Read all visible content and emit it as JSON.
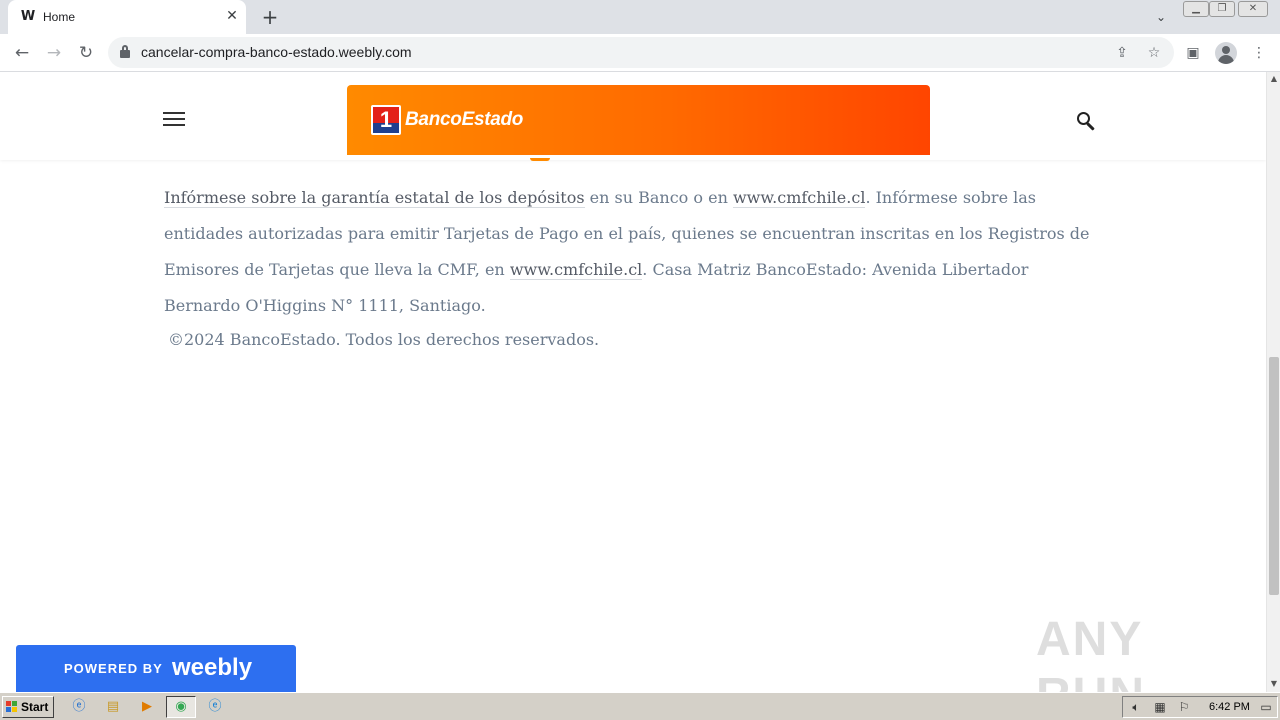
{
  "browser": {
    "tab": {
      "title": "Home",
      "favicon": "W"
    },
    "address": {
      "url": "cancelar-compra-banco-estado.weebly.com"
    }
  },
  "site": {
    "logo_text": "BancoEstado",
    "logo_mark_digit": "1",
    "paragraph": {
      "p1": "Infórmese sobre la garantía estatal de los depósitos",
      "p2": " en su Banco o en ",
      "link1": "www.cmfchile.cl",
      "p3": ". Infórmese sobre las entidades autorizadas para emitir Tarjetas de Pago en el país, quienes se encuentran inscritas en los Registros de Emisores de Tarjetas que lleva la CMF, en ",
      "link2": "www.cmfchile.cl",
      "p4": ". Casa Matriz BancoEstado: Avenida Libertador Bernardo O'Higgins N° 1111, Santiago."
    },
    "copyright": "©2024 BancoEstado. Todos los derechos reservados.",
    "badge": {
      "powered_by": "POWERED BY",
      "brand": "weebly"
    },
    "watermark": "ANY RUN"
  },
  "taskbar": {
    "start_label": "Start",
    "clock": "6:42 PM"
  },
  "colors": {
    "banner_start": "#ff8a00",
    "banner_end": "#ff4500",
    "weebly_blue": "#2d6ff0",
    "text_gray": "#6b7a8c"
  }
}
